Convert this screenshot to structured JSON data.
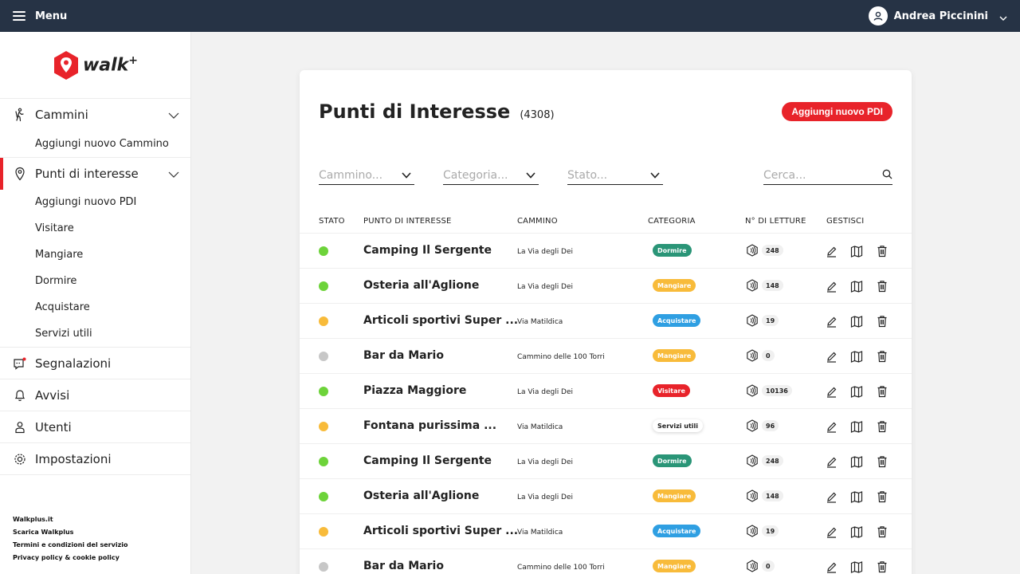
{
  "topbar": {
    "menu_label": "Menu",
    "user_name": "Andrea Piccinini"
  },
  "sidebar": {
    "logo_text": "walk",
    "logo_plus": "+",
    "cammini": {
      "label": "Cammini",
      "sub": [
        "Aggiungi nuovo Cammino"
      ]
    },
    "punti": {
      "label": "Punti di interesse",
      "sub": [
        "Aggiungi nuovo PDI",
        "Visitare",
        "Mangiare",
        "Dormire",
        "Acquistare",
        "Servizi utili"
      ]
    },
    "segnalazioni": "Segnalazioni",
    "avvisi": "Avvisi",
    "utenti": "Utenti",
    "impostazioni": "Impostazioni",
    "footer": [
      "Walkplus.it",
      "Scarica Walkplus",
      "Termini e condizioni del servizio",
      "Privacy policy & cookie policy"
    ]
  },
  "main": {
    "title": "Punti di Interesse",
    "count": "(4308)",
    "add_button": "Aggiungi nuovo PDI",
    "filters": {
      "cammino": "Cammino...",
      "categoria": "Categoria...",
      "stato": "Stato..."
    },
    "search_placeholder": "Cerca...",
    "headers": {
      "stato": "STATO",
      "punto": "PUNTO DI INTERESSE",
      "cammino": "CAMMINO",
      "categoria": "CATEGORIA",
      "letture": "N° DI LETTURE",
      "gestisci": "GESTISCI"
    },
    "rows": [
      {
        "status": "green",
        "name": "Camping Il Sergente",
        "cammino": "La Via degli Dei",
        "category": "Dormire",
        "reads": "248"
      },
      {
        "status": "green",
        "name": "Osteria all'Aglione",
        "cammino": "La Via degli Dei",
        "category": "Mangiare",
        "reads": "148"
      },
      {
        "status": "yellow",
        "name": "Articoli sportivi Super ...",
        "cammino": "Via Matildica",
        "category": "Acquistare",
        "reads": "19"
      },
      {
        "status": "gray",
        "name": "Bar da Mario",
        "cammino": "Cammino delle 100 Torri",
        "category": "Mangiare",
        "reads": "0"
      },
      {
        "status": "green",
        "name": "Piazza Maggiore",
        "cammino": "La Via degli Dei",
        "category": "Visitare",
        "reads": "10136"
      },
      {
        "status": "yellow",
        "name": "Fontana purissima ...",
        "cammino": "Via Matildica",
        "category": "Servizi utili",
        "reads": "96"
      },
      {
        "status": "green",
        "name": "Camping Il Sergente",
        "cammino": "La Via degli Dei",
        "category": "Dormire",
        "reads": "248"
      },
      {
        "status": "green",
        "name": "Osteria all'Aglione",
        "cammino": "La Via degli Dei",
        "category": "Mangiare",
        "reads": "148"
      },
      {
        "status": "yellow",
        "name": "Articoli sportivi Super ...",
        "cammino": "Via Matildica",
        "category": "Acquistare",
        "reads": "19"
      },
      {
        "status": "gray",
        "name": "Bar da Mario",
        "cammino": "Cammino delle 100 Torri",
        "category": "Mangiare",
        "reads": "0"
      }
    ]
  },
  "colors": {
    "topbar": "#263345",
    "accent_red": "#e8232a",
    "status": {
      "green": "#6dd33a",
      "yellow": "#f8bb3a",
      "gray": "#c7c7c7"
    },
    "categories": {
      "Dormire": {
        "bg": "#2a9577",
        "fg": "#ffffff"
      },
      "Mangiare": {
        "bg": "#f8bb3a",
        "fg": "#ffffff"
      },
      "Acquistare": {
        "bg": "#2f9fe2",
        "fg": "#ffffff"
      },
      "Visitare": {
        "bg": "#e8232a",
        "fg": "#ffffff"
      },
      "Servizi utili": {
        "bg": "#ffffff",
        "fg": "#222222"
      }
    }
  },
  "icons": {
    "menu": "hamburger-icon",
    "user": "user-icon",
    "cammini": "hiker-icon",
    "punti": "pin-icon",
    "segnalazioni": "chat-alert-icon",
    "avvisi": "bell-icon",
    "utenti": "person-icon",
    "impostazioni": "gear-icon",
    "reads": "nfc-tag-icon",
    "edit": "pencil-icon",
    "map": "map-icon",
    "delete": "trash-icon"
  }
}
